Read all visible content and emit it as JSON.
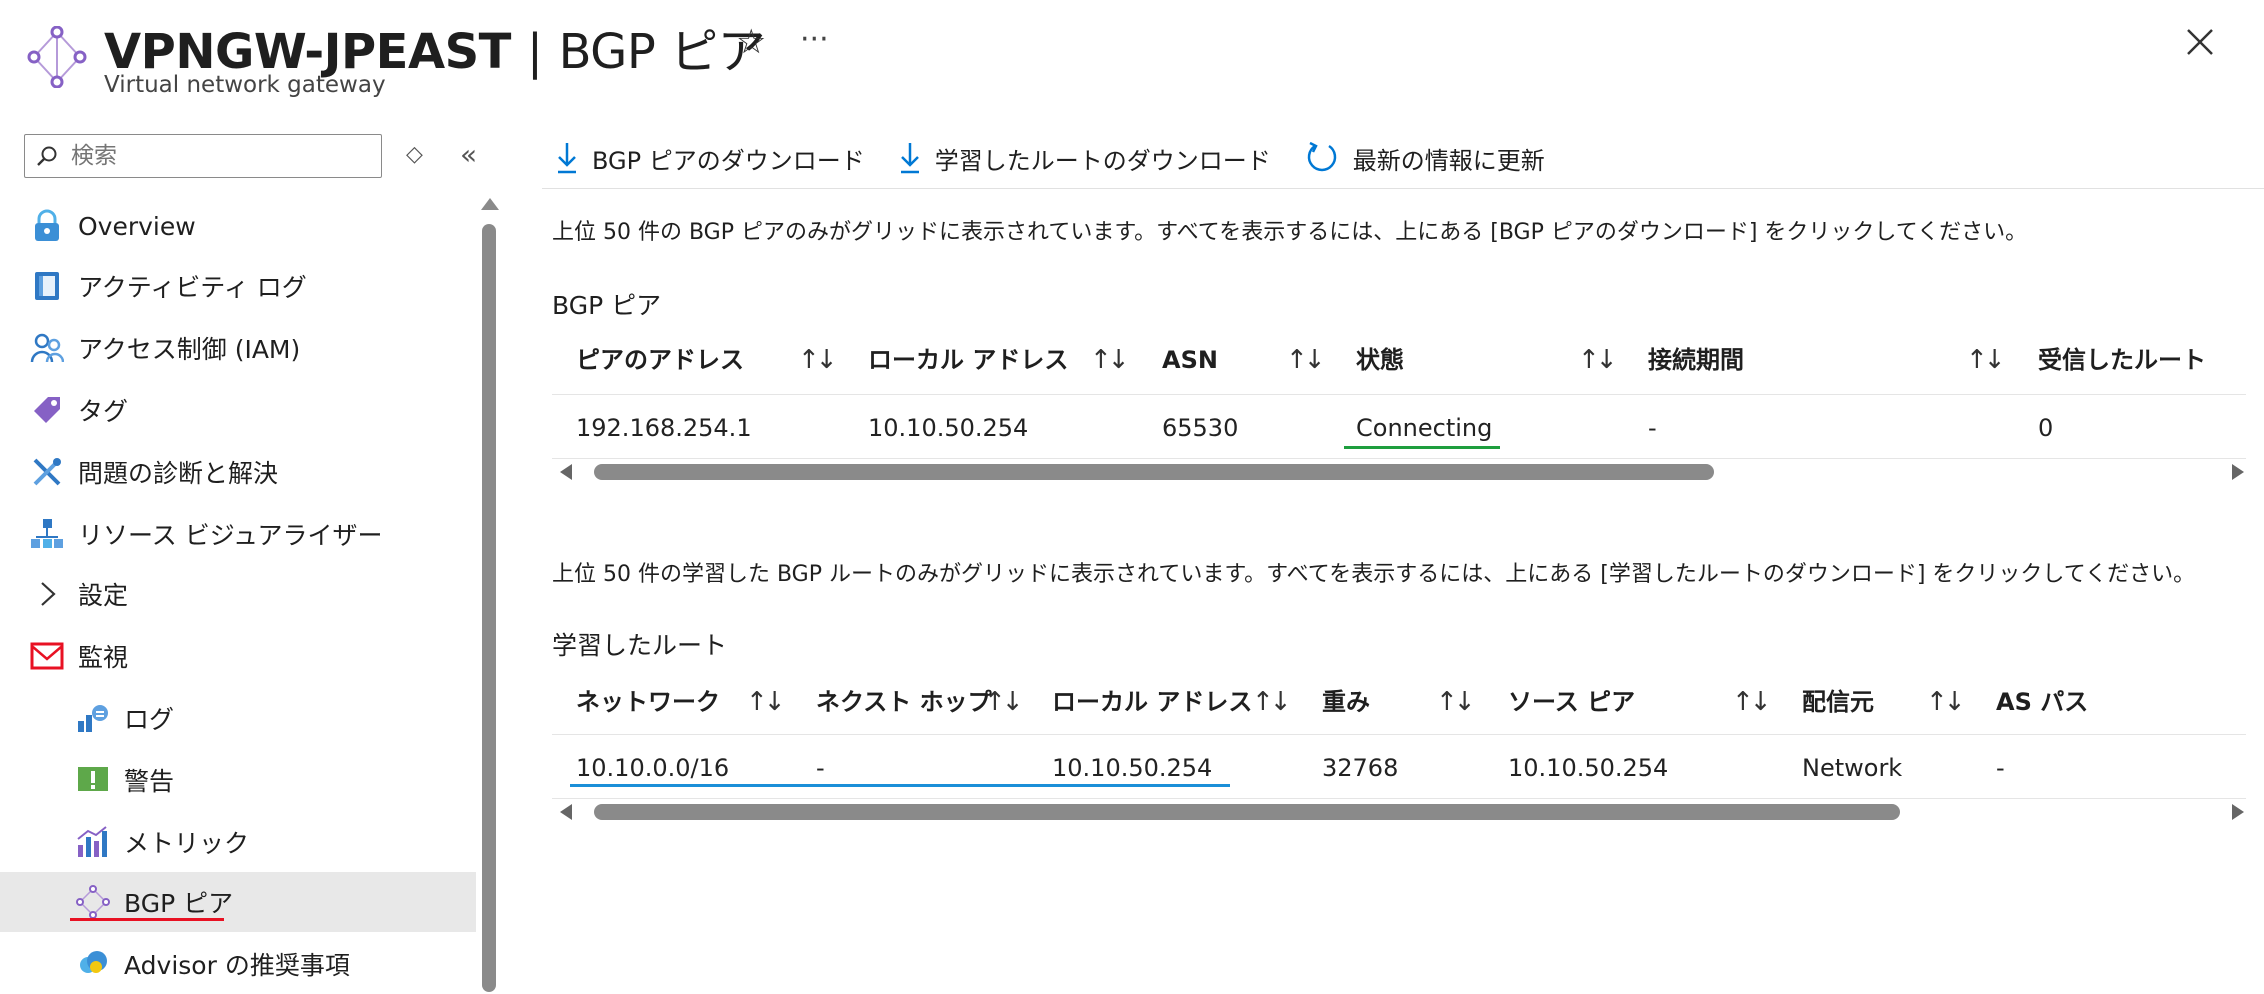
{
  "header": {
    "resource_name": "VPNGW-JPEAST",
    "separator": "|",
    "blade_title": "BGP ピア",
    "resource_type": "Virtual network gateway",
    "more": "···"
  },
  "sidebar": {
    "search_placeholder": "検索",
    "items": [
      {
        "label": "Overview",
        "icon": "overview-icon"
      },
      {
        "label": "アクティビティ ログ",
        "icon": "activity-log-icon"
      },
      {
        "label": "アクセス制御 (IAM)",
        "icon": "iam-icon"
      },
      {
        "label": "タグ",
        "icon": "tag-icon"
      },
      {
        "label": "問題の診断と解決",
        "icon": "wrench-icon"
      },
      {
        "label": "リソース ビジュアライザー",
        "icon": "resource-visualizer-icon"
      },
      {
        "label": "設定",
        "icon": "chevron-right-icon"
      },
      {
        "label": "監視",
        "icon": "monitoring-icon"
      },
      {
        "label": "ログ",
        "icon": "logs-icon"
      },
      {
        "label": "警告",
        "icon": "alerts-icon"
      },
      {
        "label": "メトリック",
        "icon": "metrics-icon"
      },
      {
        "label": "BGP ピア",
        "icon": "bgp-peer-icon",
        "selected": true
      },
      {
        "label": "Advisor の推奨事項",
        "icon": "advisor-icon"
      }
    ]
  },
  "toolbar": {
    "download_peers": "BGP ピアのダウンロード",
    "download_routes": "学習したルートのダウンロード",
    "refresh": "最新の情報に更新"
  },
  "peers": {
    "note": "上位 50 件の BGP ピアのみがグリッドに表示されています。すべてを表示するには、上にある [BGP ピアのダウンロード] をクリックしてください。",
    "title": "BGP ピア",
    "columns": [
      "ピアのアドレス",
      "ローカル アドレス",
      "ASN",
      "状態",
      "接続期間",
      "受信したルート"
    ],
    "rows": [
      [
        "192.168.254.1",
        "10.10.50.254",
        "65530",
        "Connecting",
        "-",
        "0"
      ]
    ]
  },
  "routes": {
    "note": "上位 50 件の学習した BGP ルートのみがグリッドに表示されています。すべてを表示するには、上にある [学習したルートのダウンロード] をクリックしてください。",
    "title": "学習したルート",
    "columns": [
      "ネットワーク",
      "ネクスト ホップ",
      "ローカル アドレス",
      "重み",
      "ソース ピア",
      "配信元",
      "AS パス"
    ],
    "rows": [
      [
        "10.10.0.0/16",
        "-",
        "10.10.50.254",
        "32768",
        "10.10.50.254",
        "Network",
        "-"
      ]
    ]
  },
  "colors": {
    "accent": "#0078d4",
    "highlight_green": "#1e9e3e",
    "highlight_blue": "#1b8fd8",
    "highlight_red": "#e81123",
    "selected_bg": "#e8e8e8"
  }
}
